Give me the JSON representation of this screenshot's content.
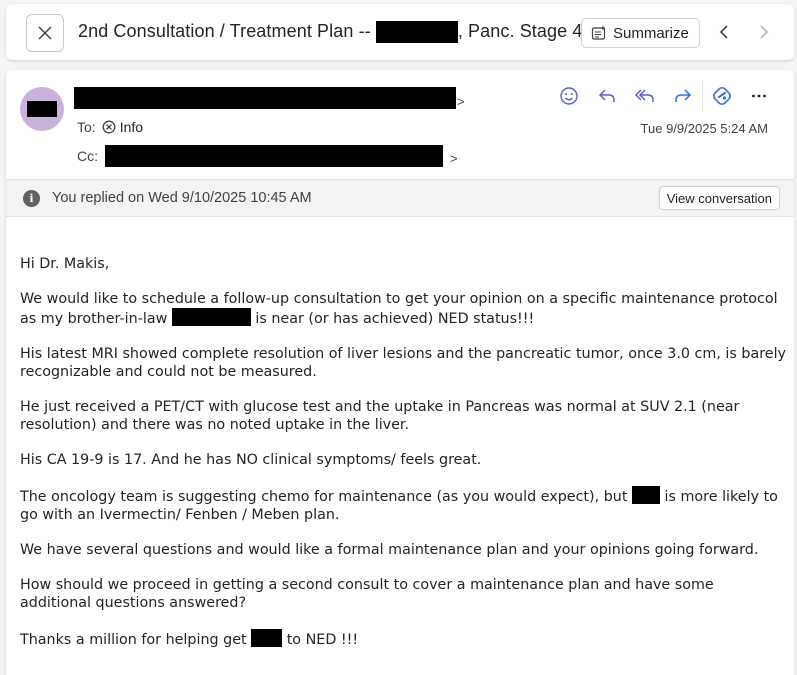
{
  "header": {
    "subject_prefix": "2nd Consultation / Treatment Plan -- ",
    "subject_suffix": ", Panc. Stage 4",
    "summarize_label": "Summarize",
    "close_icon": "close-icon",
    "prev_icon": "chevron-left-icon",
    "next_icon": "chevron-right-icon"
  },
  "message": {
    "sender_suffix": ">",
    "to_label": "To:",
    "to_recipient": "Info",
    "cc_label": "Cc:",
    "cc_suffix": ">",
    "date": "Tue 9/9/2025 5:24 AM",
    "actions": [
      "emoji-icon",
      "reply-icon",
      "reply-all-icon",
      "forward-icon",
      "loop-icon",
      "more-icon"
    ]
  },
  "info_bar": {
    "text": "You replied on Wed 9/10/2025 10:45 AM",
    "button": "View conversation"
  },
  "body": {
    "greeting": "Hi Dr. Makis,",
    "p1_a": "We would like to schedule a follow-up consultation to get your opinion on a specific maintenance protocol as my brother-in-law ",
    "p1_b": " is near (or has achieved) NED status!!!",
    "p2": "His latest MRI showed complete resolution of liver lesions and the pancreatic tumor, once 3.0 cm, is barely recognizable and could not be measured.",
    "p3": "He just received a PET/CT with glucose test and the uptake in Pancreas was normal at SUV 2.1 (near resolution) and there was no noted uptake in the liver.",
    "p4": "His CA 19-9 is 17.  And he has NO clinical symptoms/ feels great.",
    "p5_a": "The oncology team is suggesting chemo for maintenance (as you would expect), but ",
    "p5_b": " is more likely to go with an Ivermectin/ Fenben / Meben plan.",
    "p6": "We have several questions and would like a formal maintenance plan and your opinions going forward.",
    "p7": "How should we proceed in getting a second consult to cover a maintenance plan and have some additional questions answered?",
    "p8_a": "Thanks a million for helping get ",
    "p8_b": " to NED !!!"
  },
  "colors": {
    "accent": "#5b5fc7",
    "avatar_bg": "#c9b3dc",
    "loop_blue": "#2f6fd6"
  }
}
